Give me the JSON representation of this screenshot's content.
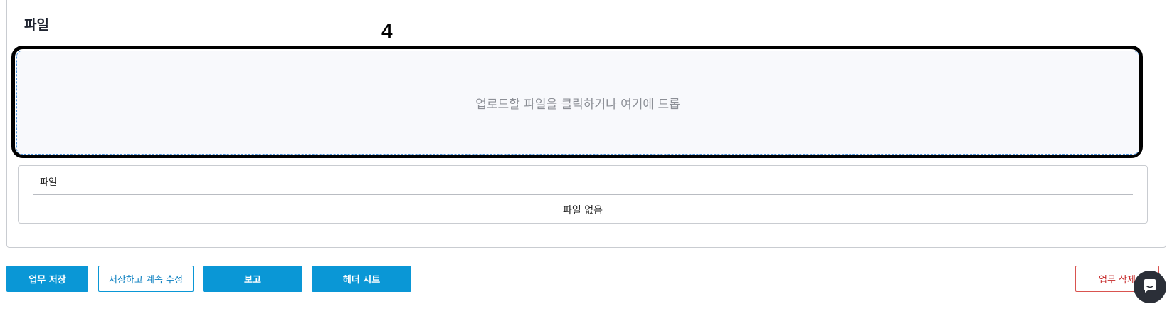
{
  "files_section": {
    "title": "파일",
    "annotation_label": "4",
    "dropzone_text": "업로드할 파일을 클릭하거나 여기에 드롭",
    "table_header": "파일",
    "empty_text": "파일 없음"
  },
  "actions": {
    "save_label": "업무 저장",
    "save_continue_label": "저장하고 계속 수정",
    "report_label": "보고",
    "header_sheet_label": "헤더 시트",
    "delete_label": "업무 삭제"
  },
  "icons": {
    "chat": "chat-icon"
  },
  "colors": {
    "primary": "#0a97d6",
    "danger": "#c62828",
    "dropzone_border": "#4a90d9",
    "annotation": "#000000"
  }
}
